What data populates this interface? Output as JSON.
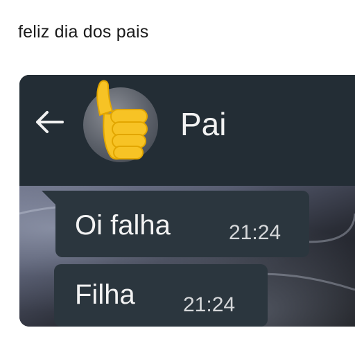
{
  "caption": "feliz dia dos pais",
  "chat": {
    "contact_name": "Pai",
    "messages": [
      {
        "text": "Oi falha",
        "time": "21:24"
      },
      {
        "text": "Filha",
        "time": "21:24"
      }
    ]
  },
  "icons": {
    "back": "back-arrow-icon",
    "avatar_overlay": "thumbs-up-emoji"
  },
  "colors": {
    "header": "#232d35",
    "bubble": "#2b363e",
    "emoji": "#f7c325"
  }
}
